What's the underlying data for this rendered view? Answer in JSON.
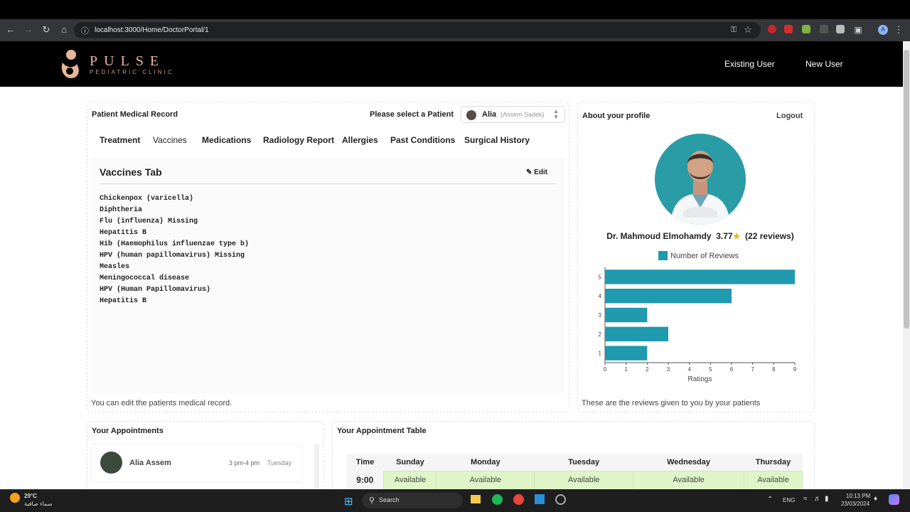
{
  "browser": {
    "url": "localhost:3000/Home/DoctorPortal/1",
    "account_initial": "A"
  },
  "site": {
    "logo_title": "PULSE",
    "logo_subtitle": "PEDIATRIC CLINIC",
    "nav": [
      "Existing User",
      "New User"
    ]
  },
  "record": {
    "title": "Patient Medical Record",
    "select_label": "Please select a Patient",
    "selected_patient": "Alia",
    "selected_patient_sub": "(Assem Sadek)",
    "tabs": [
      "Treatment",
      "Vaccines",
      "Medications",
      "Radiology Report",
      "Allergies",
      "Past Conditions",
      "Surgical History"
    ],
    "panel_title": "Vaccines Tab",
    "edit_label": "Edit",
    "vaccines": [
      "Chickenpox (varicella)",
      "Diphtheria",
      "Flu (influenza) Missing",
      "Hepatitis B",
      "Hib (Haemophilus influenzae type b)",
      "HPV (human papillomavirus) Missing",
      "Measles",
      "Meningococcal disease",
      "HPV (Human Papillomavirus)",
      "Hepatitis B"
    ],
    "helper": "You can edit the patients medical record."
  },
  "profile": {
    "title": "About your profile",
    "logout_label": "Logout",
    "doctor_name": "Dr. Mahmoud Elmohamdy",
    "rating": "3.77",
    "reviews": "(22 reviews)",
    "helper": "These are the reviews given to you by your patients"
  },
  "chart_data": {
    "type": "bar",
    "orientation": "horizontal",
    "categories": [
      "5",
      "4",
      "3",
      "2",
      "1"
    ],
    "series": [
      {
        "name": "Number of Reviews",
        "values": [
          9,
          6,
          2,
          3,
          2
        ]
      }
    ],
    "xlabel": "Ratings",
    "ylabel": "",
    "xlim": [
      0,
      9
    ],
    "xticks": [
      "0",
      "1",
      "2",
      "3",
      "4",
      "5",
      "6",
      "7",
      "8",
      "9"
    ],
    "legend": "top",
    "color": "#1f9aae"
  },
  "appointments": {
    "title": "Your Appointments",
    "items": [
      {
        "name": "Alia Assem",
        "time": "3 pm-4 pm",
        "day": "Tuesday"
      }
    ]
  },
  "schedule": {
    "title": "Your Appointment Table",
    "headers": [
      "Time",
      "Sunday",
      "Monday",
      "Tuesday",
      "Wednesday",
      "Thursday"
    ],
    "rows": [
      {
        "time": "9:00",
        "cells": [
          "Available",
          "Available",
          "Available",
          "Available",
          "Available"
        ]
      }
    ]
  },
  "taskbar": {
    "temperature": "29°C",
    "weather": "سماء صافية",
    "search_label": "Search",
    "lang": "ENG",
    "time": "10:13 PM",
    "date": "23/03/2024"
  }
}
